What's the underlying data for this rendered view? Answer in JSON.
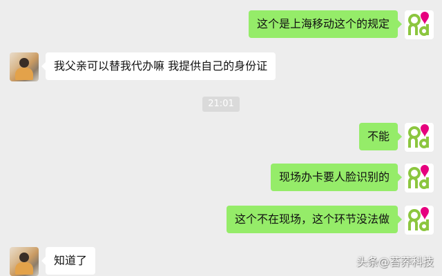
{
  "timestamp": "21:01",
  "brand_avatar_text": "and",
  "messages": [
    {
      "side": "right",
      "text": "这个是上海移动这个的规定"
    },
    {
      "side": "left",
      "text": "我父亲可以替我代办嘛 我提供自己的身份证"
    },
    {
      "side": "right",
      "text": "不能"
    },
    {
      "side": "right",
      "text": "现场办卡要人脸识别的"
    },
    {
      "side": "right",
      "text": "这个不在现场，这个环节没法做"
    },
    {
      "side": "left",
      "text": "知道了"
    }
  ],
  "watermark": "头条@苔荞科技",
  "colors": {
    "self_bubble": "#95ec69",
    "other_bubble": "#ffffff",
    "background": "#ededed",
    "brand_pink": "#e6007e",
    "brand_green": "#8cc63f"
  }
}
